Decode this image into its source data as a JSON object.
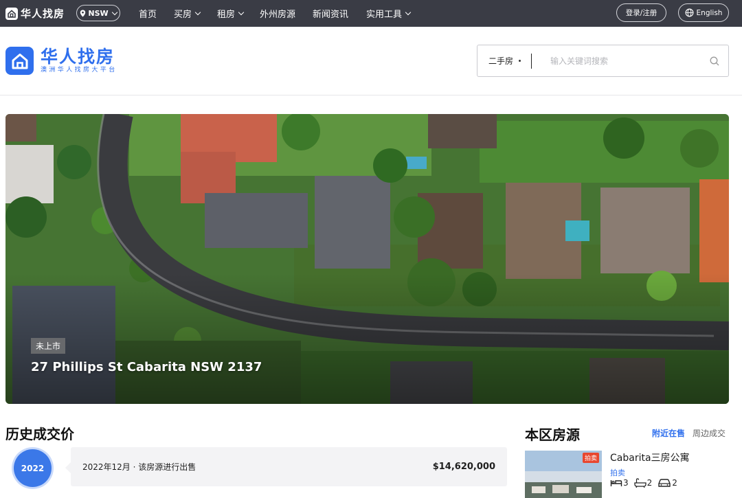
{
  "topbar": {
    "logo_text": "华人找房",
    "region": "NSW",
    "nav": [
      {
        "label": "首页"
      },
      {
        "label": "买房"
      },
      {
        "label": "租房"
      },
      {
        "label": "外州房源"
      },
      {
        "label": "新闻资讯"
      },
      {
        "label": "实用工具"
      }
    ],
    "login_label": "登录/注册",
    "lang_label": "English"
  },
  "header": {
    "brand_name": "华人找房",
    "slogan": "澳洲华人找房大平台",
    "search_category": "二手房",
    "search_placeholder": "输入关键词搜索"
  },
  "hero": {
    "badge": "未上市",
    "address": "27 Phillips St Cabarita NSW 2137"
  },
  "history": {
    "title": "历史成交价",
    "year": "2022",
    "event": "2022年12月 · 该房源进行出售",
    "price": "$14,620,000"
  },
  "local": {
    "title": "本区房源",
    "tabs": [
      "附近在售",
      "周边成交"
    ],
    "listing": {
      "tag": "拍卖",
      "title": "Cabarita三房公寓",
      "type": "拍卖",
      "beds": "3",
      "baths": "2",
      "cars": "2"
    }
  },
  "colors": {
    "brand": "#2f6fed",
    "topbar": "#3a3c45",
    "auction_tag": "#e8472f"
  }
}
